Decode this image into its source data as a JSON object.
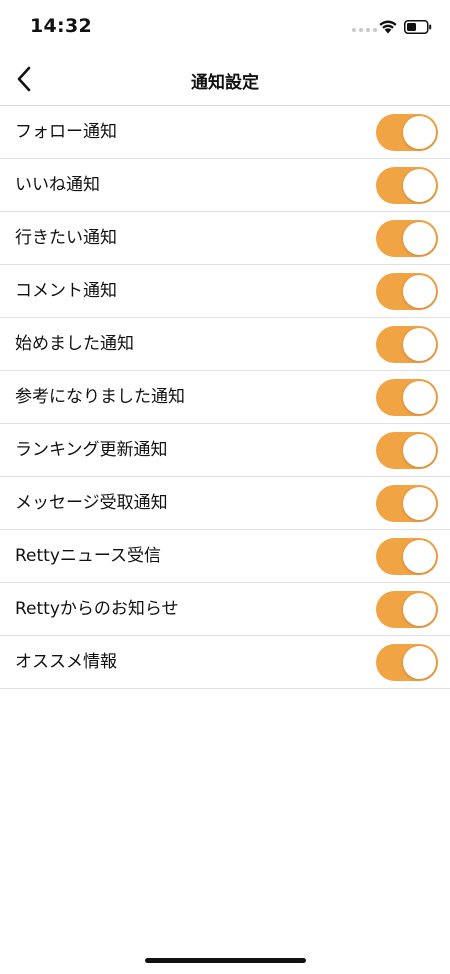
{
  "status_bar": {
    "time": "14:32"
  },
  "nav": {
    "title": "通知設定",
    "back_icon": "chevron-left-icon"
  },
  "colors": {
    "toggle_on": "#f1a444"
  },
  "settings": [
    {
      "label": "フォロー通知",
      "enabled": true
    },
    {
      "label": "いいね通知",
      "enabled": true
    },
    {
      "label": "行きたい通知",
      "enabled": true
    },
    {
      "label": "コメント通知",
      "enabled": true
    },
    {
      "label": "始めました通知",
      "enabled": true
    },
    {
      "label": "参考になりました通知",
      "enabled": true
    },
    {
      "label": "ランキング更新通知",
      "enabled": true
    },
    {
      "label": "メッセージ受取通知",
      "enabled": true
    },
    {
      "label": "Rettyニュース受信",
      "enabled": true
    },
    {
      "label": "Rettyからのお知らせ",
      "enabled": true
    },
    {
      "label": "オススメ情報",
      "enabled": true
    }
  ]
}
